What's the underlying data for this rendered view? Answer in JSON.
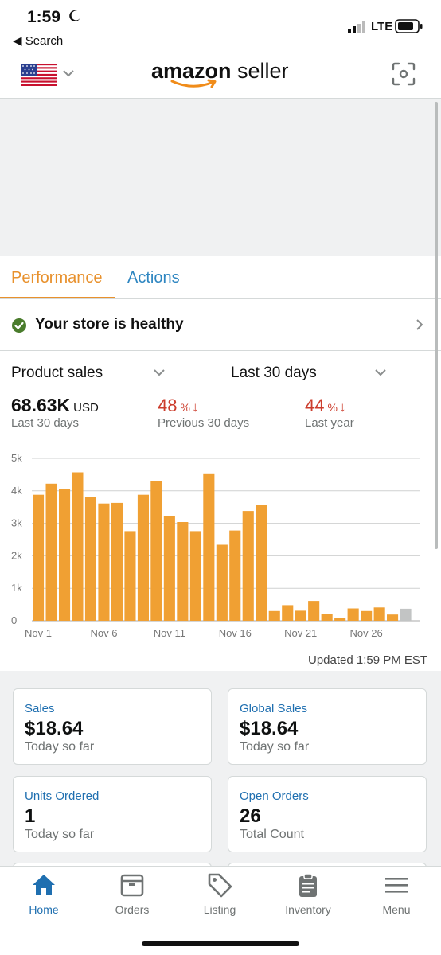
{
  "status_bar": {
    "time": "1:59",
    "network": "LTE",
    "back_label": "◀ Search"
  },
  "header": {
    "logo_bold": "amazon",
    "logo_light": " seller"
  },
  "tabs": [
    {
      "label": "Performance",
      "active": true
    },
    {
      "label": "Actions",
      "active": false
    }
  ],
  "health": {
    "text": "Your store is healthy",
    "status_color": "#4a7c2c"
  },
  "selectors": {
    "metric": "Product sales",
    "range": "Last 30 days"
  },
  "stats": {
    "main_value": "68.63K",
    "main_unit": "USD",
    "main_sub": "Last 30 days",
    "prev_value": "48",
    "prev_pct": "%",
    "prev_sub": "Previous 30 days",
    "ly_value": "44",
    "ly_pct": "%",
    "ly_sub": "Last year",
    "down_color": "#cc3d2d"
  },
  "chart_data": {
    "type": "bar",
    "categories": [
      "Nov 1",
      "Nov 2",
      "Nov 3",
      "Nov 4",
      "Nov 5",
      "Nov 6",
      "Nov 7",
      "Nov 8",
      "Nov 9",
      "Nov 10",
      "Nov 11",
      "Nov 12",
      "Nov 13",
      "Nov 14",
      "Nov 15",
      "Nov 16",
      "Nov 17",
      "Nov 18",
      "Nov 19",
      "Nov 20",
      "Nov 21",
      "Nov 22",
      "Nov 23",
      "Nov 24",
      "Nov 25",
      "Nov 26",
      "Nov 27",
      "Nov 28",
      "Nov 29"
    ],
    "values": [
      3880,
      4220,
      4060,
      4570,
      3810,
      3610,
      3630,
      2760,
      3880,
      4310,
      3210,
      3040,
      2760,
      4540,
      2340,
      2780,
      3380,
      3560,
      300,
      480,
      310,
      610,
      200,
      90,
      380,
      300,
      410,
      190,
      370
    ],
    "x_tick_labels": [
      "Nov 1",
      "Nov 6",
      "Nov 11",
      "Nov 16",
      "Nov 21",
      "Nov 26"
    ],
    "y_tick_labels": [
      "0",
      "1k",
      "2k",
      "3k",
      "4k",
      "5k"
    ],
    "ylim": [
      0,
      5000
    ],
    "bar_color": "#f0a033",
    "partial_bar_color": "#c2c4c4",
    "grid": true
  },
  "updated": "Updated 1:59 PM EST",
  "cards": [
    {
      "title": "Sales",
      "value": "$18.64",
      "sub": "Today so far"
    },
    {
      "title": "Global Sales",
      "value": "$18.64",
      "sub": "Today so far"
    },
    {
      "title": "Units Ordered",
      "value": "1",
      "sub": "Today so far"
    },
    {
      "title": "Open Orders",
      "value": "26",
      "sub": "Total Count"
    }
  ],
  "nav": [
    {
      "label": "Home",
      "icon": "home-icon",
      "active": true
    },
    {
      "label": "Orders",
      "icon": "orders-icon",
      "active": false
    },
    {
      "label": "Listing",
      "icon": "tag-icon",
      "active": false
    },
    {
      "label": "Inventory",
      "icon": "clipboard-icon",
      "active": false
    },
    {
      "label": "Menu",
      "icon": "hamburger-icon",
      "active": false
    }
  ],
  "colors": {
    "accent": "#e8912d",
    "link": "#2e86c1",
    "nav_active": "#1f6fb0"
  }
}
